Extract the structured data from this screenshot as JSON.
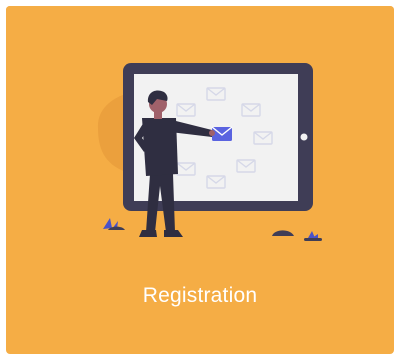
{
  "card": {
    "label": "Registration",
    "icon": "man-sorting-mail-on-tablet-illustration",
    "colors": {
      "card_background": "#F5AD45",
      "blob": "#EBA03D",
      "tablet_frame": "#3F3D56",
      "tablet_screen": "#F2F2F2",
      "envelope_outline": "#D6D8E8",
      "envelope_highlight": "#5A63E0",
      "label_text": "#FFFFFF"
    }
  }
}
